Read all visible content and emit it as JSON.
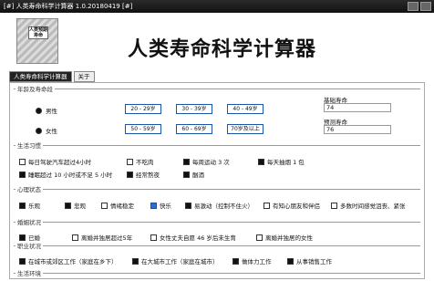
{
  "window": {
    "title": "[#] 人类寿命科学计算器 1.0.20180419 [#]"
  },
  "header": {
    "logo_text": "人类预期寿命",
    "title": "人类寿命科学计算器"
  },
  "tabs": [
    {
      "label": "人类寿命科学计算器",
      "active": true
    },
    {
      "label": "关于",
      "active": false
    }
  ],
  "age_group": {
    "title": "年龄及寿命段",
    "male_label": "男性",
    "female_label": "女性",
    "male_selected": true,
    "female_selected": true,
    "male_buttons": [
      "20 - 29岁",
      "30 - 39岁",
      "40 - 49岁"
    ],
    "female_buttons": [
      "50 - 59岁",
      "60 - 69岁",
      "70岁及以上"
    ],
    "basic_life_label": "基础寿命",
    "basic_life_value": "74",
    "predicted_life_label": "预测寿命",
    "predicted_life_value": "76"
  },
  "life_habits": {
    "title": "生活习惯",
    "items": [
      {
        "label": "每日驾驶汽车超过4小时",
        "checked": false
      },
      {
        "label": "不吃肉",
        "checked": false
      },
      {
        "label": "每周运动 3 次",
        "checked": true
      },
      {
        "label": "每天抽烟 1 包",
        "checked": true
      },
      {
        "label": "睡眠超过 10 小时或不足 5 小时",
        "checked": true
      },
      {
        "label": "经常熬夜",
        "checked": true
      },
      {
        "label": "酗酒",
        "checked": true
      }
    ]
  },
  "mental_state": {
    "title": "心理状态",
    "items": [
      {
        "label": "乐观",
        "checked": true,
        "style": "dark"
      },
      {
        "label": "悲观",
        "checked": true,
        "style": "dark"
      },
      {
        "label": "情绪稳定",
        "checked": false,
        "style": "plain"
      },
      {
        "label": "快乐",
        "checked": true,
        "style": "blue"
      },
      {
        "label": "易激动（控制不住火）",
        "checked": true,
        "style": "dark"
      },
      {
        "label": "有知心朋友和伴侣",
        "checked": false,
        "style": "plain"
      },
      {
        "label": "多数时间感觉沮丧、紧张",
        "checked": false,
        "style": "plain"
      }
    ]
  },
  "marriage": {
    "title": "婚姻状况",
    "items": [
      {
        "label": "已婚",
        "checked": true
      },
      {
        "label": "离婚并独居超过5年",
        "checked": false
      },
      {
        "label": "女性丈夫自愿 46 岁后未生育",
        "checked": false
      },
      {
        "label": "离婚并独居的女性",
        "checked": false
      }
    ]
  },
  "work": {
    "title": "职业状况",
    "items": [
      {
        "label": "在城市或郊区工作（家庭在乡下）",
        "checked": true
      },
      {
        "label": "在大城市工作（家庭在城市）",
        "checked": true
      },
      {
        "label": "做体力工作",
        "checked": true
      },
      {
        "label": "从事销售工作",
        "checked": true
      }
    ]
  },
  "living_env": {
    "title": "生活环境"
  }
}
